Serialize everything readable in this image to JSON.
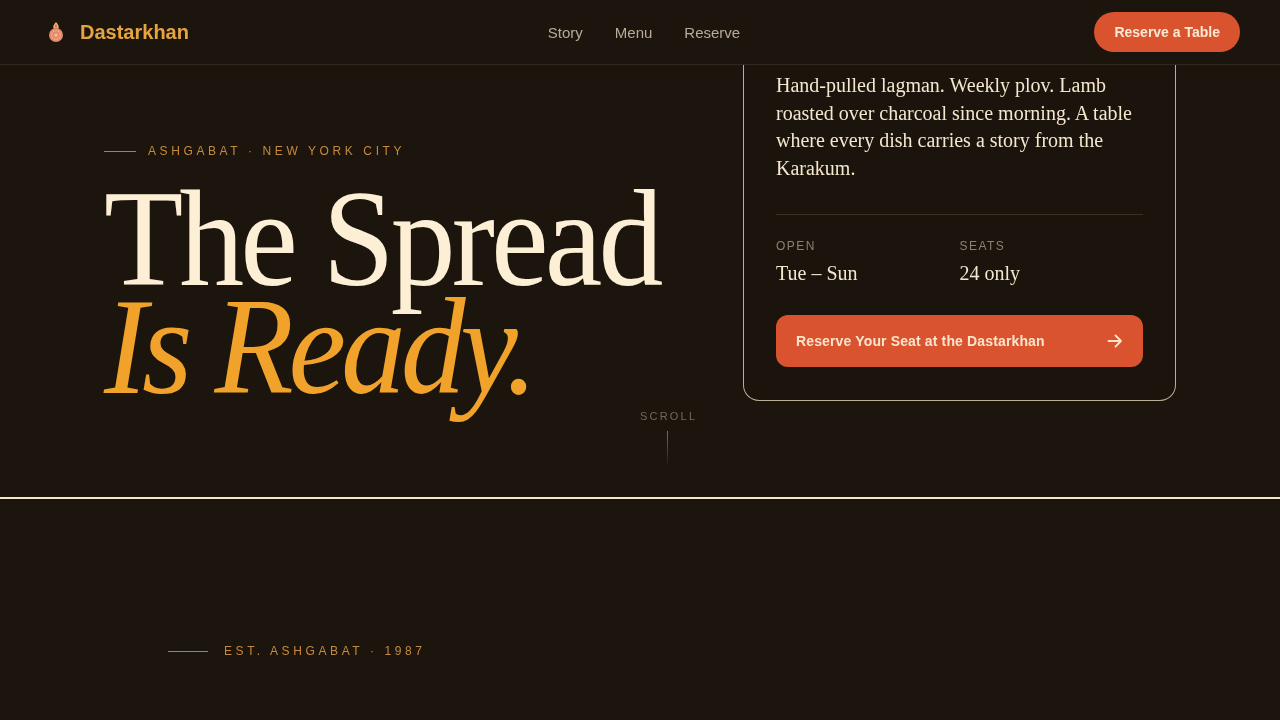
{
  "header": {
    "brand": "Dastarkhan",
    "nav": [
      "Story",
      "Menu",
      "Reserve"
    ],
    "cta": "Reserve a Table"
  },
  "hero": {
    "eyebrow": "ASHGABAT · NEW YORK CITY",
    "title_line_1": "The Spread",
    "title_line_2": "Is Ready.",
    "scroll_label": "SCROLL"
  },
  "card": {
    "description": "Hand-pulled lagman. Weekly plov. Lamb roasted over charcoal since morning. A table where every dish carries a story from the Karakum.",
    "facts": [
      {
        "label": "OPEN",
        "value": "Tue – Sun"
      },
      {
        "label": "SEATS",
        "value": "24 only"
      }
    ],
    "button": "Reserve Your Seat at the Dastarkhan"
  },
  "story": {
    "eyebrow": "EST. ASHGABAT · 1987"
  }
}
